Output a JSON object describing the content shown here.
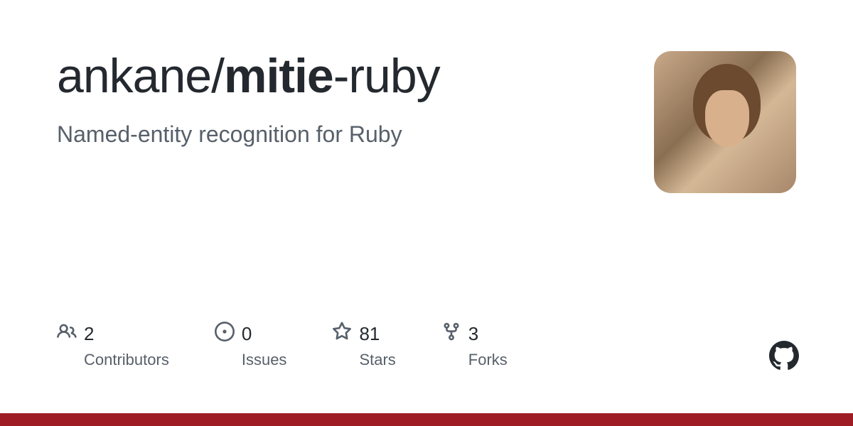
{
  "repo": {
    "owner": "ankane",
    "slash": "/",
    "name_bold": "mitie",
    "name_tail": "-ruby",
    "description": "Named-entity recognition for Ruby"
  },
  "stats": {
    "contributors": {
      "value": "2",
      "label": "Contributors"
    },
    "issues": {
      "value": "0",
      "label": "Issues"
    },
    "stars": {
      "value": "81",
      "label": "Stars"
    },
    "forks": {
      "value": "3",
      "label": "Forks"
    }
  },
  "colors": {
    "accent_bar": "#9e1c23"
  }
}
